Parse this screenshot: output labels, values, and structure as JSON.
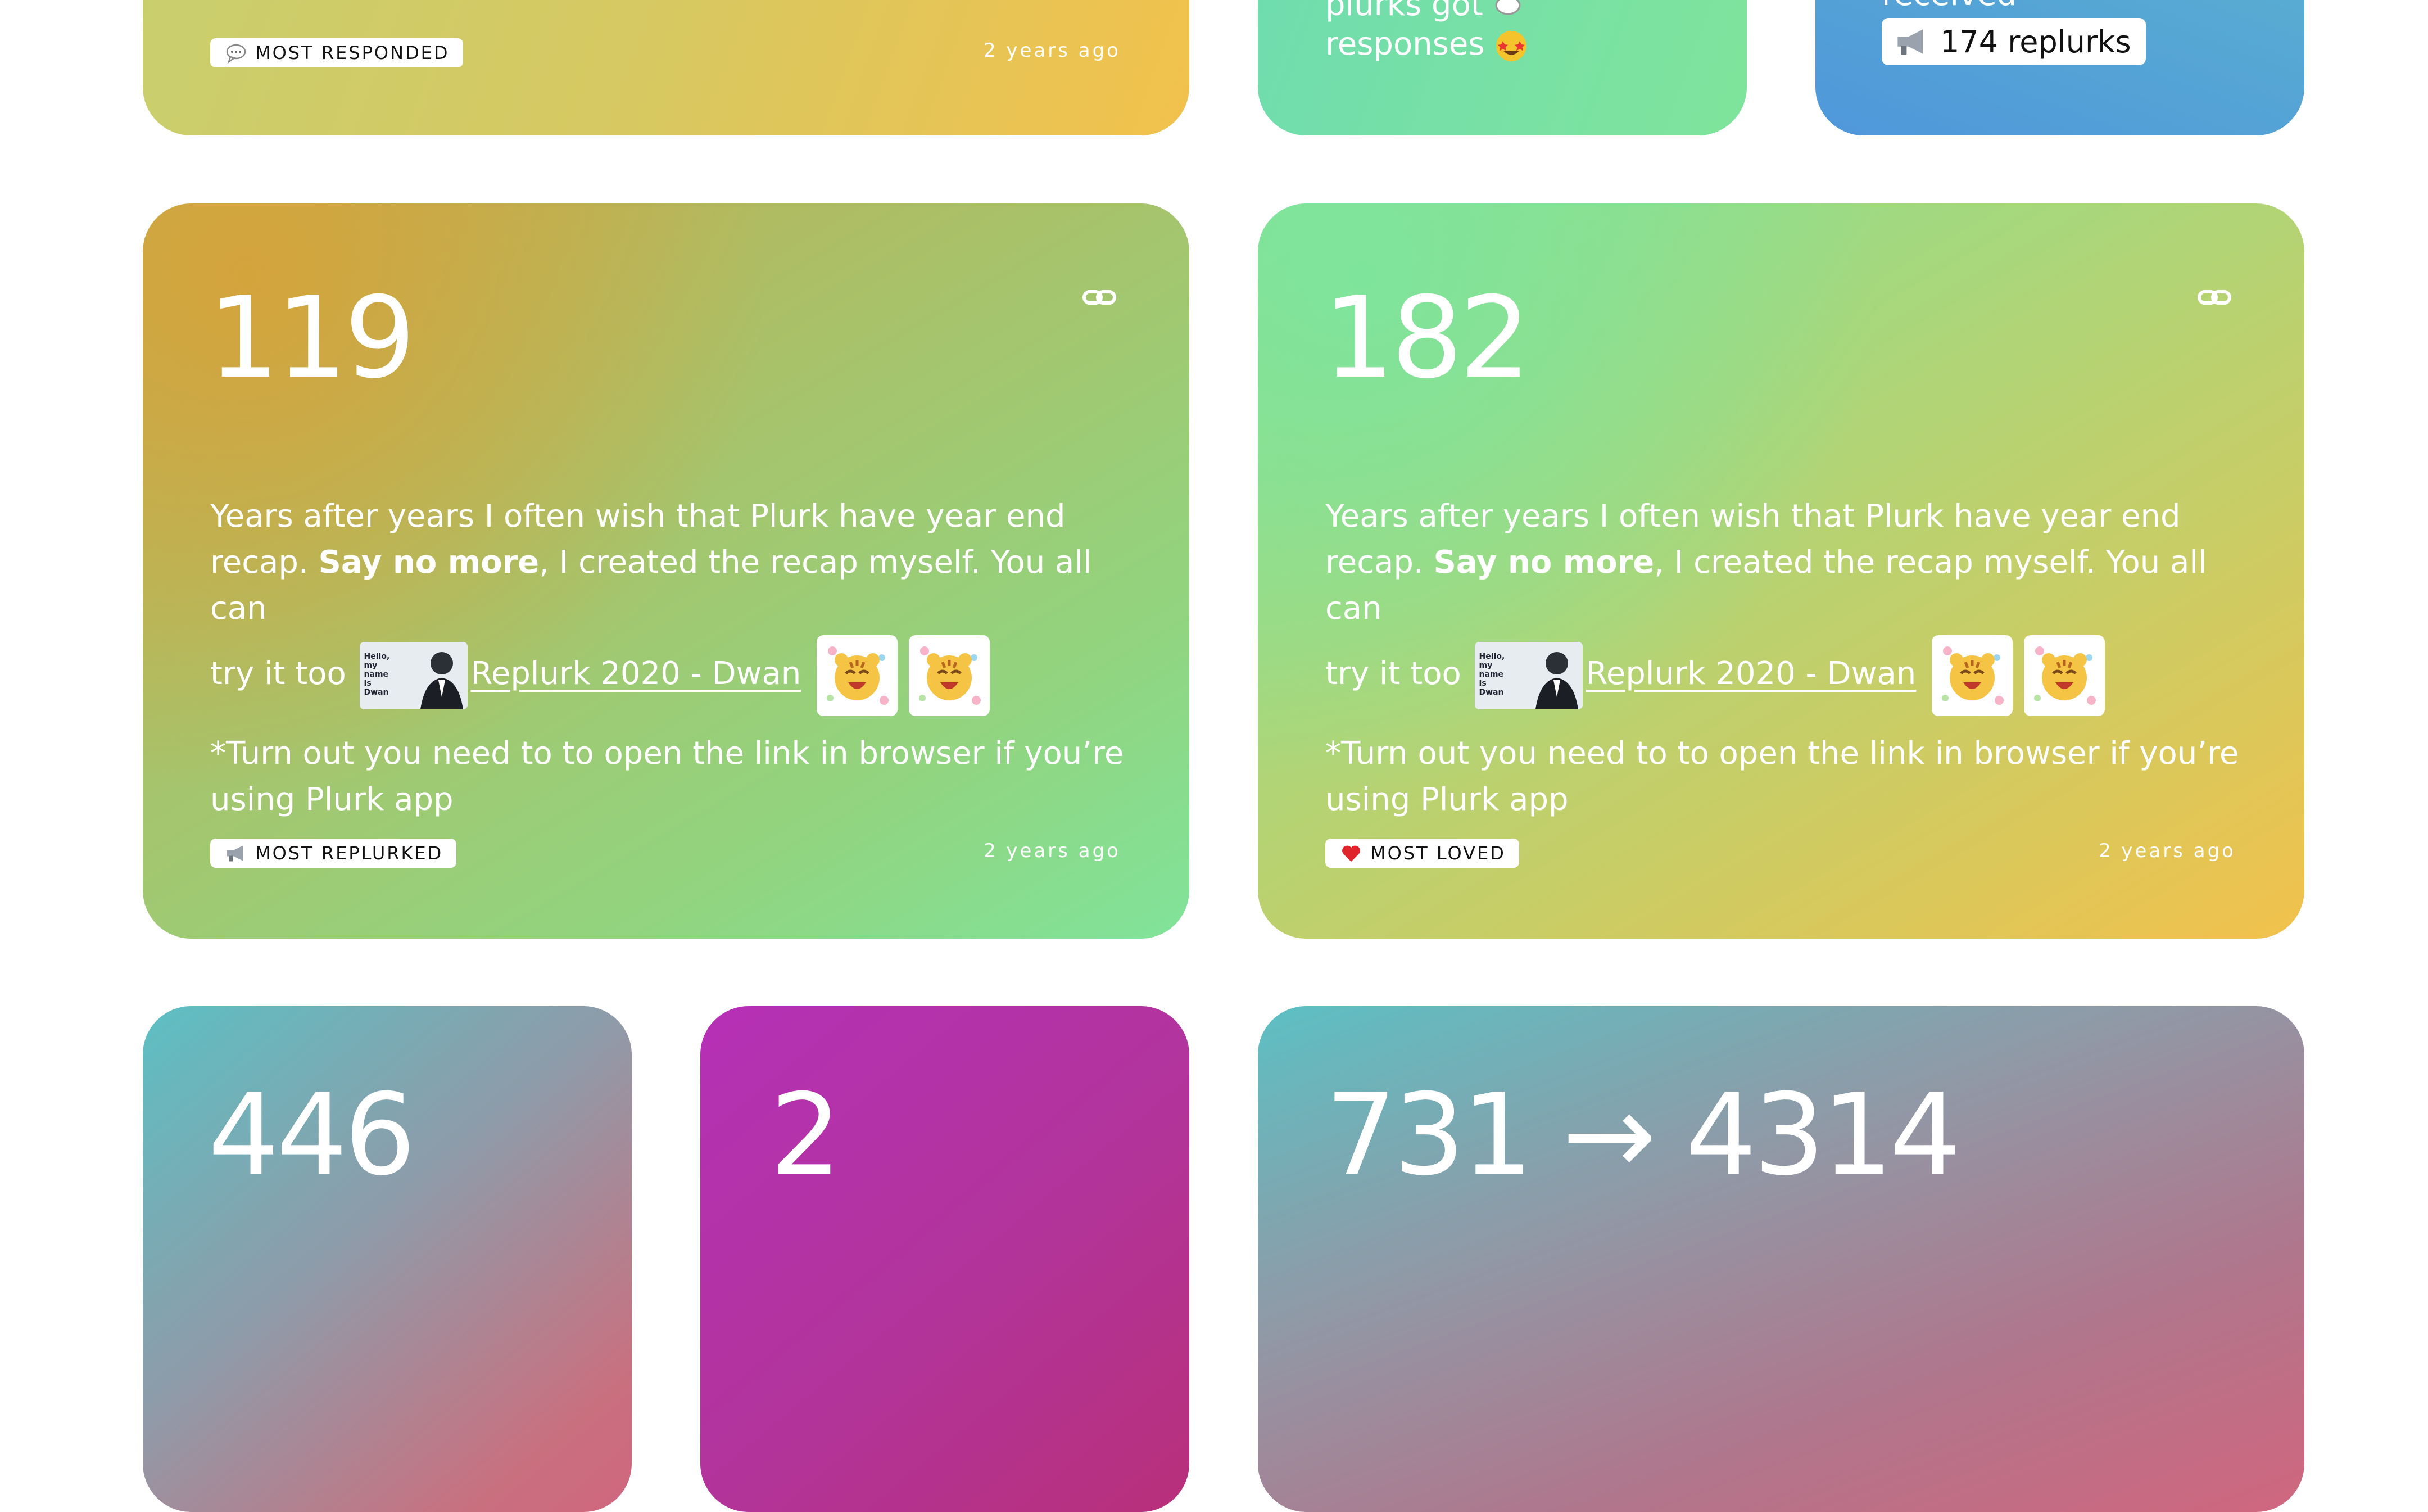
{
  "top_row": {
    "left_card": {
      "badge": "MOST RESPONDED",
      "time": "2 years ago",
      "badge_icon": "speech-bubble-icon"
    },
    "middle_card": {
      "line1": "plurks got",
      "line2": "responses"
    },
    "right_card": {
      "line1": "received",
      "pill": "174 replurks",
      "pill_icon": "megaphone-icon"
    }
  },
  "post_text": {
    "line1": "Years after years I often wish that Plurk have year end",
    "line2_pre": "recap. ",
    "line2_bold": "Say no more",
    "line2_post": ", I created the recap myself. You all can",
    "line3_pre": "try it too",
    "link": "Replurk 2020 - Dwan",
    "thumb_text": "Hello, my name is Dwan",
    "note_line1": "*Turn out you need to to open the link in browser if you’re",
    "note_line2": "using Plurk app"
  },
  "cards": [
    {
      "number": "119",
      "badge": "MOST REPLURKED",
      "badge_icon": "megaphone-icon",
      "time": "2 years ago",
      "link_icon": "link-icon"
    },
    {
      "number": "182",
      "badge": "MOST LOVED",
      "badge_icon": "heart-icon",
      "time": "2 years ago",
      "link_icon": "link-icon"
    }
  ],
  "bottom_row": [
    {
      "number": "446"
    },
    {
      "number": "2"
    },
    {
      "number": "731 → 4314"
    }
  ],
  "colors": {
    "yellow": "#f2c14c",
    "green": "#7fe49b",
    "olive": "#c9a13a",
    "teal": "#5cc0c3",
    "blue": "#4f97db",
    "pink": "#d0667e",
    "magenta": "#b530b6"
  }
}
